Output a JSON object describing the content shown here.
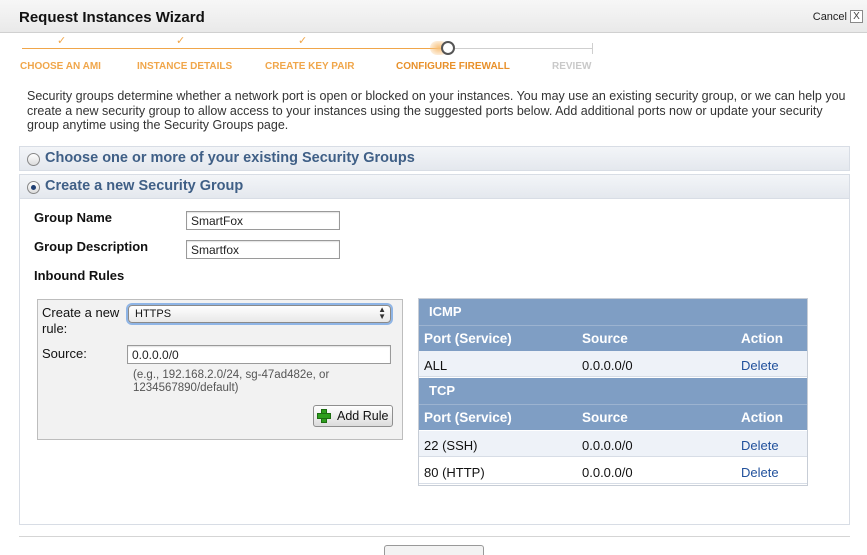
{
  "window": {
    "title": "Request Instances Wizard",
    "cancel_label": "Cancel",
    "close_glyph": "X"
  },
  "steps": {
    "items": [
      {
        "label": "CHOOSE AN AMI",
        "state": "done"
      },
      {
        "label": "INSTANCE DETAILS",
        "state": "done"
      },
      {
        "label": "CREATE KEY PAIR",
        "state": "done"
      },
      {
        "label": "CONFIGURE FIREWALL",
        "state": "current"
      },
      {
        "label": "REVIEW",
        "state": "todo"
      }
    ],
    "check_glyph": "✓"
  },
  "intro": "Security groups determine whether a network port is open or blocked on your instances. You may use an existing security group, or we can help you create a new security group to allow access to your instances using the suggested ports below. Add additional ports now or update your security group anytime using the Security Groups page.",
  "options": {
    "existing_label": "Choose one or more of your existing Security Groups",
    "new_label": "Create a new Security Group",
    "selected": "new"
  },
  "form": {
    "group_name_label": "Group Name",
    "group_name_value": "SmartFox",
    "group_desc_label": "Group Description",
    "group_desc_value": "Smartfox",
    "inbound_label": "Inbound Rules"
  },
  "rule_editor": {
    "create_label": "Create a new rule:",
    "rule_value": "HTTPS",
    "source_label": "Source:",
    "source_value": "0.0.0.0/0",
    "hint": "(e.g., 192.168.2.0/24, sg-47ad482e, or 1234567890/default)",
    "add_button": "Add Rule"
  },
  "rules_table": {
    "columns": [
      "Port (Service)",
      "Source",
      "Action"
    ],
    "groups": [
      {
        "name": "ICMP",
        "rows": [
          {
            "port": "ALL",
            "source": "0.0.0.0/0",
            "action": "Delete"
          }
        ]
      },
      {
        "name": "TCP",
        "rows": [
          {
            "port": "22 (SSH)",
            "source": "0.0.0.0/0",
            "action": "Delete"
          },
          {
            "port": "80 (HTTP)",
            "source": "0.0.0.0/0",
            "action": "Delete"
          }
        ]
      }
    ]
  },
  "colors": {
    "step_accent": "#f0a64a",
    "section_header": "#3f5f86",
    "table_header": "#7f9ec4",
    "link": "#21519c"
  }
}
